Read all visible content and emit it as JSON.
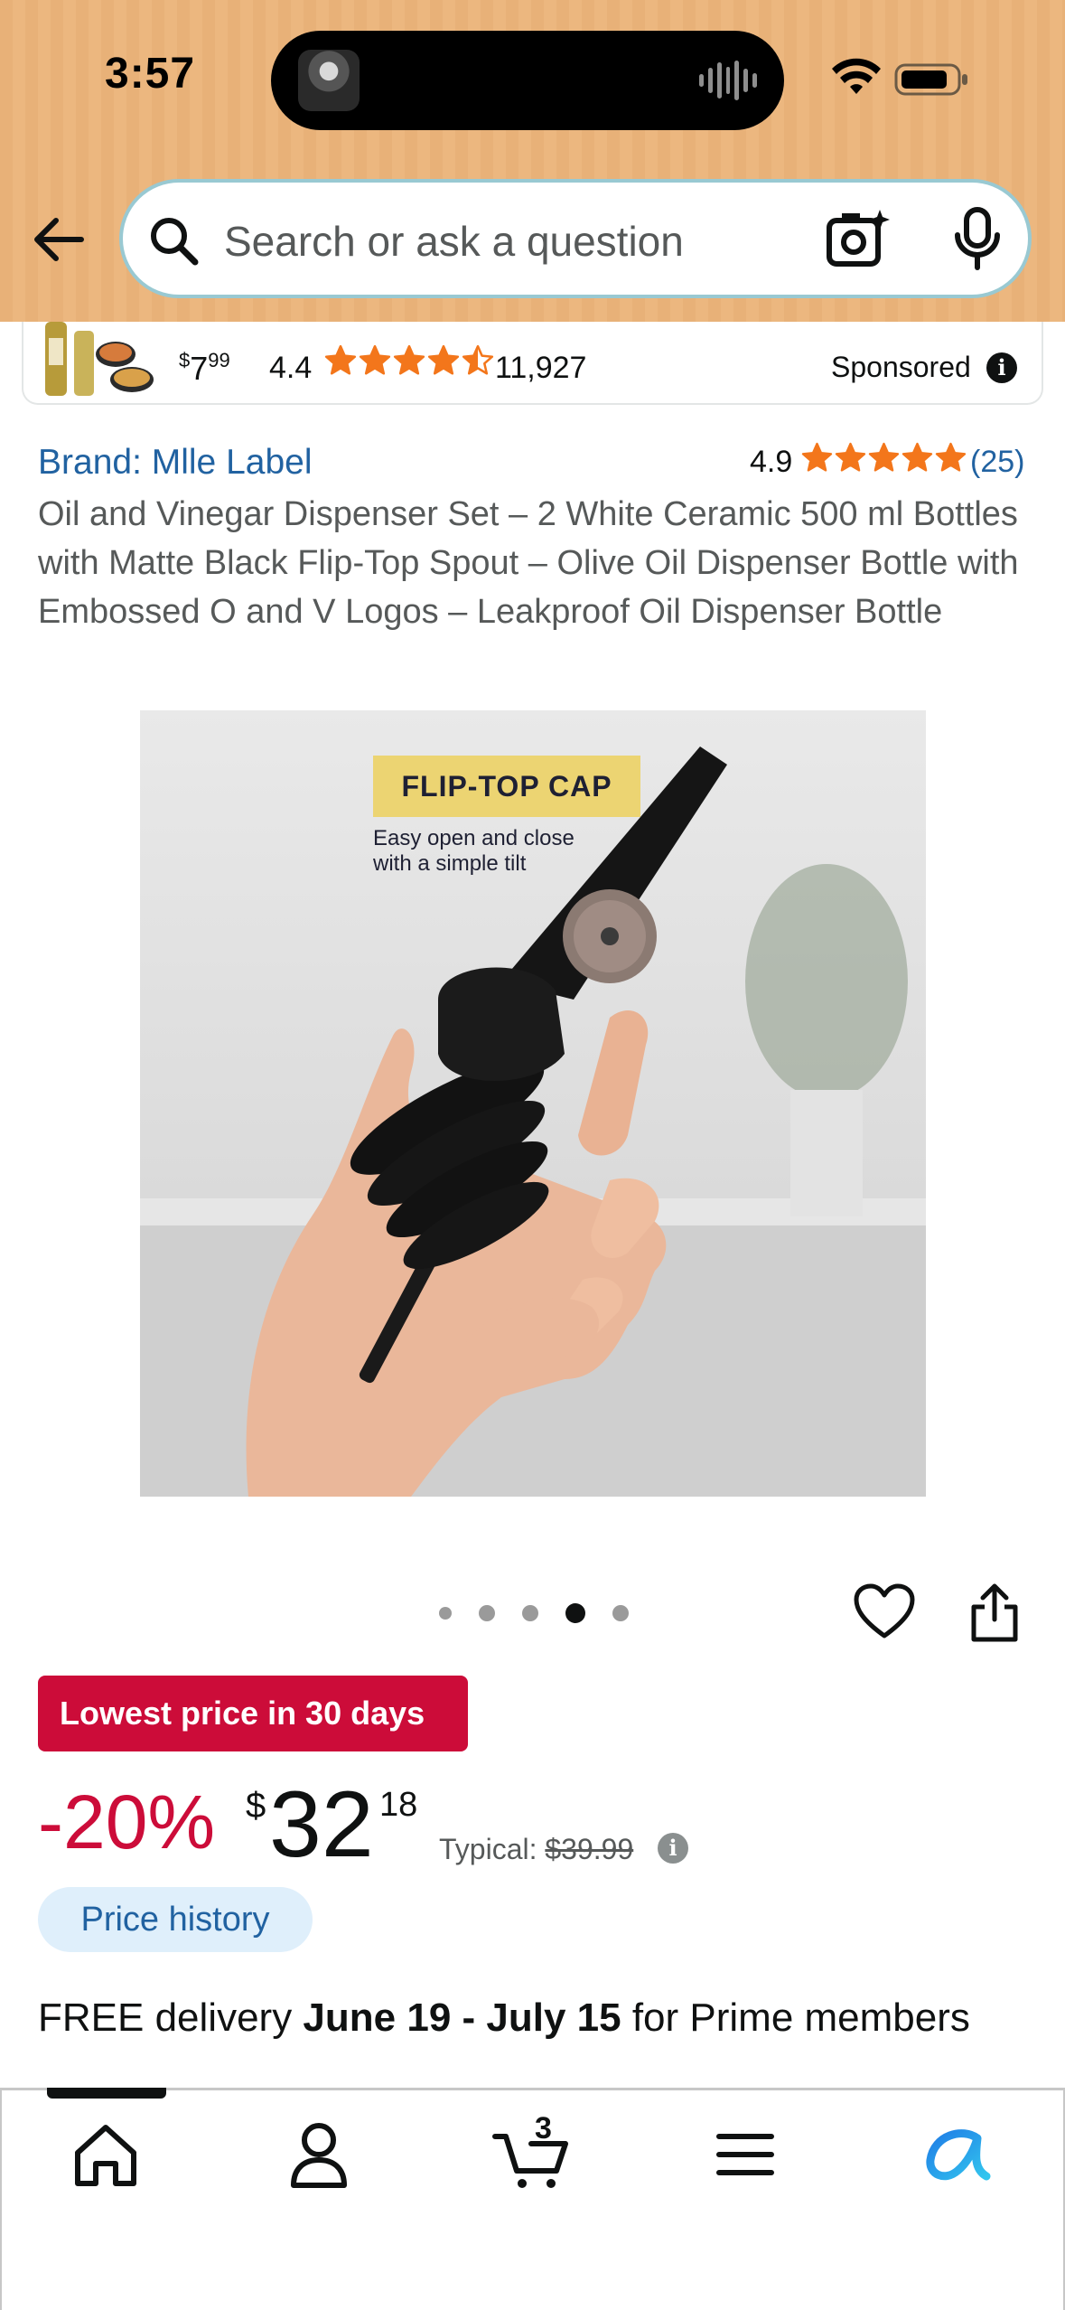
{
  "status_bar": {
    "time": "3:57"
  },
  "search": {
    "placeholder": "Search or ask a question"
  },
  "sponsored_strip": {
    "price_dollars": "7",
    "price_cents": "99",
    "rating": "4.4",
    "stars": 4.5,
    "review_count": "11,927",
    "label": "Sponsored"
  },
  "product": {
    "brand": "Brand: Mlle Label",
    "rating": "4.9",
    "stars": 5,
    "review_count": "(25)",
    "title": "Oil and Vinegar Dispenser Set – 2 White Ceramic 500 ml Bottles with Matte Black Flip-Top Spout – Olive Oil Dispenser Bottle with Embossed O and V Logos – Leakproof Oil Dispenser Bottle",
    "image_badge": "FLIP-TOP CAP",
    "image_caption": "Easy open and close with a simple tilt",
    "carousel": {
      "total": 5,
      "active_index": 3
    }
  },
  "pricing": {
    "deal_badge": "Lowest price in 30 days",
    "discount": "-20%",
    "currency": "$",
    "price_whole": "32",
    "price_fraction": "18",
    "typical_label": "Typical:",
    "typical_price": "$39.99",
    "price_history": "Price history"
  },
  "delivery": {
    "prefix": "FREE delivery ",
    "dates": "June 19 - July 15",
    "suffix": " for Prime members"
  },
  "bottom_nav": {
    "cart_count": "3",
    "items": [
      "home-icon",
      "account-icon",
      "cart-icon",
      "menu-icon",
      "rufus-ai-icon"
    ]
  },
  "colors": {
    "header_bg": "#e8b178",
    "deal_red": "#cc0c39",
    "link_blue": "#2162a1",
    "star_orange": "#f3761b",
    "price_history_bg": "#dfeffb"
  }
}
